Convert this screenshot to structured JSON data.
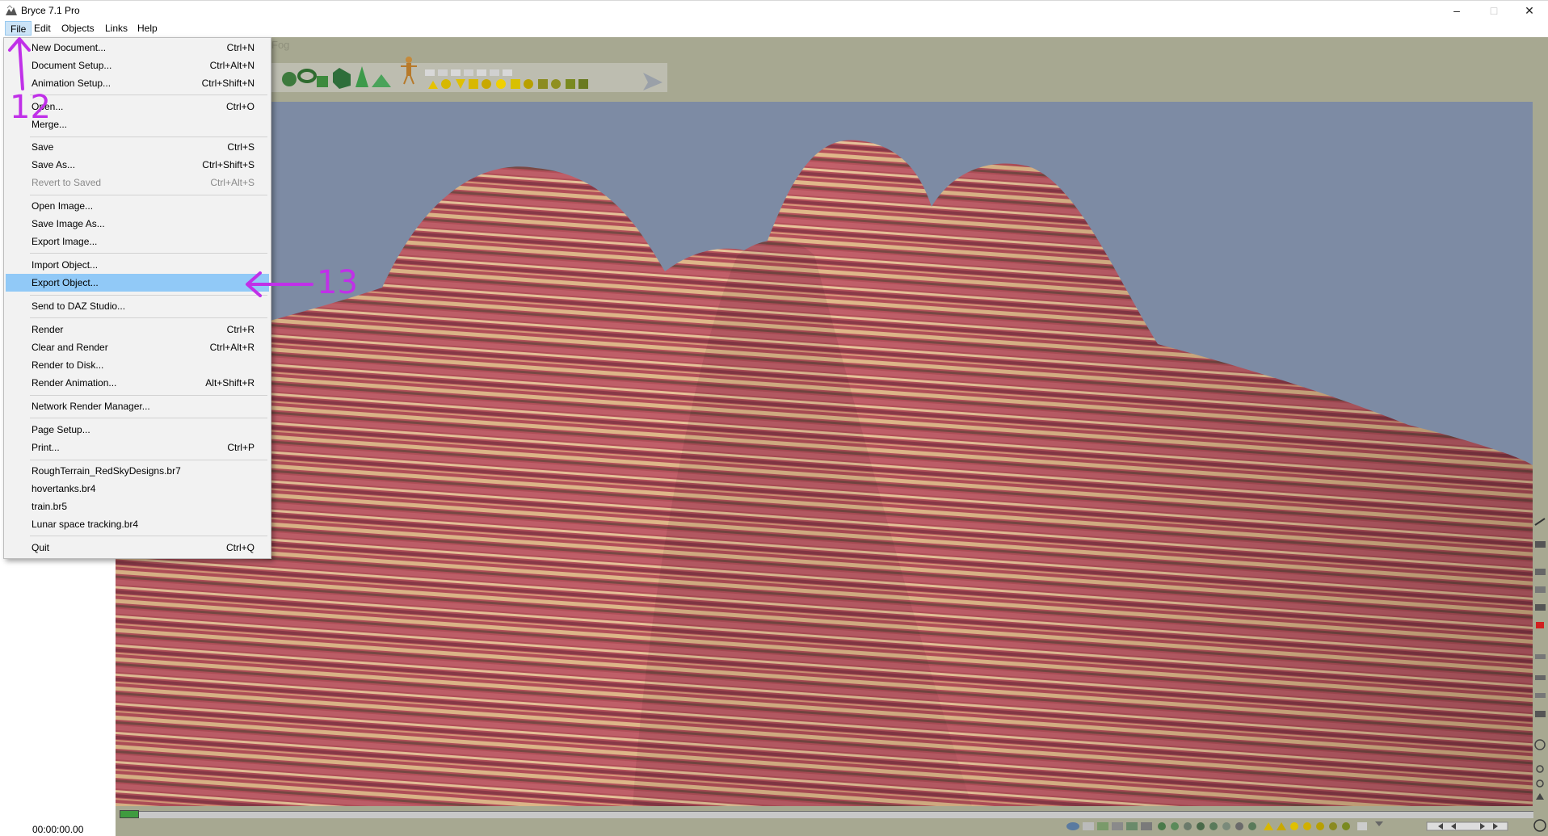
{
  "window": {
    "title": "Bryce 7.1  Pro",
    "minimize": "–",
    "maximize": "□",
    "close": "✕"
  },
  "menubar": [
    {
      "label": "File"
    },
    {
      "label": "Edit"
    },
    {
      "label": "Objects"
    },
    {
      "label": "Links"
    },
    {
      "label": "Help"
    }
  ],
  "toolbar": {
    "fog_label": "Fog"
  },
  "file_menu": {
    "items": [
      {
        "label": "New Document...",
        "shortcut": "Ctrl+N"
      },
      {
        "label": "Document Setup...",
        "shortcut": "Ctrl+Alt+N"
      },
      {
        "label": "Animation Setup...",
        "shortcut": "Ctrl+Shift+N"
      },
      {
        "label": "Open...",
        "shortcut": "Ctrl+O"
      },
      {
        "label": "Merge...",
        "shortcut": ""
      },
      {
        "label": "Save",
        "shortcut": "Ctrl+S"
      },
      {
        "label": "Save As...",
        "shortcut": "Ctrl+Shift+S"
      },
      {
        "label": "Revert to Saved",
        "shortcut": "Ctrl+Alt+S"
      },
      {
        "label": "Open Image...",
        "shortcut": ""
      },
      {
        "label": "Save Image As...",
        "shortcut": ""
      },
      {
        "label": "Export Image...",
        "shortcut": ""
      },
      {
        "label": "Import Object...",
        "shortcut": ""
      },
      {
        "label": "Export Object...",
        "shortcut": ""
      },
      {
        "label": "Send to DAZ Studio...",
        "shortcut": ""
      },
      {
        "label": "Render",
        "shortcut": "Ctrl+R"
      },
      {
        "label": "Clear and Render",
        "shortcut": "Ctrl+Alt+R"
      },
      {
        "label": "Render to Disk...",
        "shortcut": ""
      },
      {
        "label": "Render Animation...",
        "shortcut": "Alt+Shift+R"
      },
      {
        "label": "Network Render Manager...",
        "shortcut": ""
      },
      {
        "label": "Page Setup...",
        "shortcut": ""
      },
      {
        "label": "Print...",
        "shortcut": "Ctrl+P"
      },
      {
        "label": "RoughTerrain_RedSkyDesigns.br7",
        "shortcut": ""
      },
      {
        "label": "hovertanks.br4",
        "shortcut": ""
      },
      {
        "label": "train.br5",
        "shortcut": ""
      },
      {
        "label": "Lunar space tracking.br4",
        "shortcut": ""
      },
      {
        "label": "Quit",
        "shortcut": "Ctrl+Q"
      }
    ]
  },
  "annotations": {
    "step_12": "12",
    "step_13": "13"
  },
  "status": {
    "timecode": "00:00:00.00"
  },
  "colors": {
    "annotation": "#c030e8",
    "highlight": "#91c9f7",
    "sky": "#7d8ba4",
    "workspace": "#a7a891"
  }
}
